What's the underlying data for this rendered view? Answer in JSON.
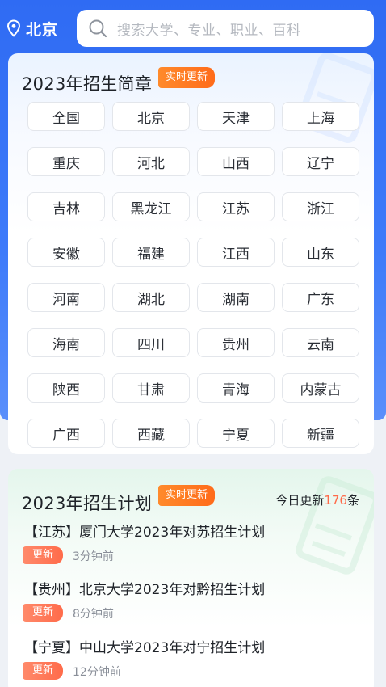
{
  "header": {
    "city": "北京",
    "search_placeholder": "搜索大学、专业、职业、百科"
  },
  "brochure": {
    "title": "2023年招生简章",
    "badge": "实时更新",
    "regions": [
      "全国",
      "北京",
      "天津",
      "上海",
      "重庆",
      "河北",
      "山西",
      "辽宁",
      "吉林",
      "黑龙江",
      "江苏",
      "浙江",
      "安徽",
      "福建",
      "江西",
      "山东",
      "河南",
      "湖北",
      "湖南",
      "广东",
      "海南",
      "四川",
      "贵州",
      "云南",
      "陕西",
      "甘肃",
      "青海",
      "内蒙古",
      "广西",
      "西藏",
      "宁夏",
      "新疆"
    ]
  },
  "plan": {
    "title": "2023年招生计划",
    "badge": "实时更新",
    "today_prefix": "今日更新",
    "today_count": "176",
    "today_suffix": "条",
    "items": [
      {
        "title": "【江苏】厦门大学2023年对苏招生计划",
        "tag": "更新",
        "time": "3分钟前"
      },
      {
        "title": "【贵州】北京大学2023年对黔招生计划",
        "tag": "更新",
        "time": "8分钟前"
      },
      {
        "title": "【宁夏】中山大学2023年对宁招生计划",
        "tag": "更新",
        "time": "12分钟前"
      }
    ]
  },
  "colors": {
    "primary_blue": "#2f6bf3",
    "badge_orange": "#ff6b1a",
    "count_red": "#ff6b4a"
  },
  "icons": {
    "location": "location-pin-icon",
    "search": "search-icon"
  }
}
